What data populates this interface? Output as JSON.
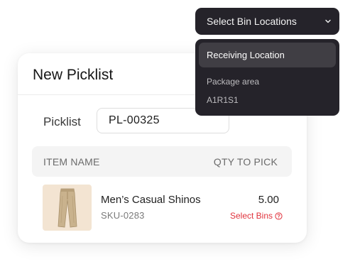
{
  "card": {
    "title": "New Picklist",
    "picklist_label": "Picklist",
    "picklist_value": "PL-00325"
  },
  "table": {
    "columns": [
      "ITEM NAME",
      "QTY TO PICK"
    ],
    "rows": [
      {
        "name": "Men’s Casual Shinos",
        "sku": "SKU-0283",
        "qty": "5.00",
        "action": "Select Bins",
        "thumbnail": "khaki-pants-image"
      }
    ]
  },
  "dropdown": {
    "label": "Select Bin Locations",
    "icon": "chevron-down-icon",
    "options": [
      "Receiving Location",
      "Package area",
      "A1R1S1"
    ],
    "highlighted": "Receiving Location"
  },
  "colors": {
    "accent_red": "#e0323c",
    "dropdown_bg": "#25232a",
    "dropdown_highlight": "#403e44",
    "thumbnail_bg": "#f3e4d2"
  }
}
